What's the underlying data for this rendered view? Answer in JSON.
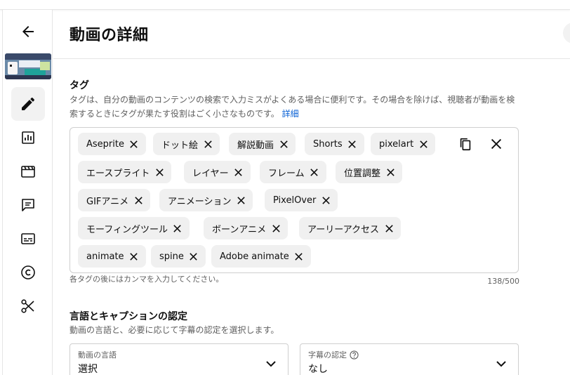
{
  "header": {
    "title": "動画の詳細"
  },
  "rail": {
    "back_icon": "arrow-left-icon",
    "items": [
      {
        "icon": "pencil-icon",
        "active": true
      },
      {
        "icon": "analytics-icon",
        "active": false
      },
      {
        "icon": "editor-icon",
        "active": false
      },
      {
        "icon": "comments-icon",
        "active": false
      },
      {
        "icon": "subtitles-icon",
        "active": false
      },
      {
        "icon": "copyright-icon",
        "active": false
      },
      {
        "icon": "scissors-icon",
        "active": false
      }
    ]
  },
  "tags": {
    "title": "タグ",
    "description": "タグは、自分の動画のコンテンツの検索で入力ミスがよくある場合に便利です。その場合を除けば、視聴者が動画を検索するときにタグが果たす役割はごく小さなものです。",
    "details_link": "詳細",
    "chips": [
      "Aseprite",
      "ドット絵",
      "解説動画",
      "Shorts",
      "pixelart",
      "エースプライト",
      "レイヤー",
      "フレーム",
      "位置調整",
      "GIFアニメ",
      "アニメーション",
      "PixelOver",
      "モーフィングツール",
      "ボーンアニメ",
      "アーリーアクセス",
      "animate",
      "spine",
      "Adobe animate"
    ],
    "hint": "各タグの後にはカンマを入力してください。",
    "count": "138/500"
  },
  "language": {
    "title": "言語とキャプションの認定",
    "description": "動画の言語と、必要に応じて字幕の認定を選択します。",
    "video_language": {
      "label": "動画の言語",
      "value": "選択"
    },
    "caption_cert": {
      "label": "字幕の認定",
      "value": "なし"
    }
  },
  "colors": {
    "accent": "#065fd4",
    "chip_bg": "#f0f0f0",
    "border": "#cfcfcf"
  }
}
